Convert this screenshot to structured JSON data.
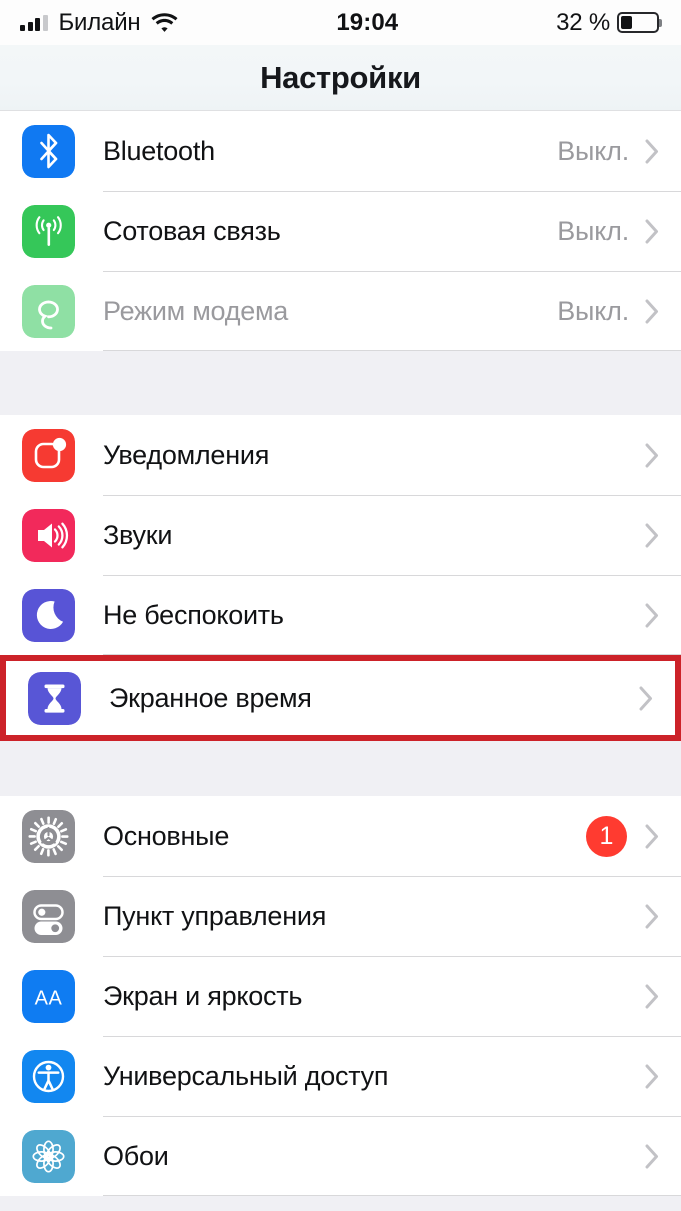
{
  "status_bar": {
    "carrier": "Билайн",
    "signal_bars_total": 4,
    "signal_bars_filled": 3,
    "wifi_icon": "wifi-icon",
    "time": "19:04",
    "battery_percent_label": "32 %",
    "battery_level": 32
  },
  "navbar": {
    "title": "Настройки"
  },
  "groups": [
    {
      "id": "connectivity",
      "rows": [
        {
          "id": "bluetooth",
          "icon": "bluetooth-icon",
          "icon_color": "#1079f2",
          "label": "Bluetooth",
          "value": "Выкл.",
          "disabled": false,
          "chevron": true,
          "badge": null
        },
        {
          "id": "cellular",
          "icon": "cellular-antenna-icon",
          "icon_color": "#35c759",
          "label": "Сотовая связь",
          "value": "Выкл.",
          "disabled": false,
          "chevron": true,
          "badge": null
        },
        {
          "id": "hotspot",
          "icon": "personal-hotspot-icon",
          "icon_color": "#8fe0a4",
          "label": "Режим модема",
          "value": "Выкл.",
          "disabled": true,
          "chevron": true,
          "badge": null
        }
      ]
    },
    {
      "id": "alerts",
      "rows": [
        {
          "id": "notifications",
          "icon": "notifications-icon",
          "icon_color": "#f63a32",
          "label": "Уведомления",
          "value": "",
          "disabled": false,
          "chevron": true,
          "badge": null
        },
        {
          "id": "sounds",
          "icon": "speaker-icon",
          "icon_color": "#f2295b",
          "label": "Звуки",
          "value": "",
          "disabled": false,
          "chevron": true,
          "badge": null
        },
        {
          "id": "do-not-disturb",
          "icon": "moon-icon",
          "icon_color": "#5854d6",
          "label": "Не беспокоить",
          "value": "",
          "disabled": false,
          "chevron": true,
          "badge": null
        }
      ]
    },
    {
      "id": "screen-time",
      "highlighted": true,
      "highlight_color": "#cc2229",
      "rows": [
        {
          "id": "screen-time",
          "icon": "hourglass-icon",
          "icon_color": "#5856d6",
          "label": "Экранное время",
          "value": "",
          "disabled": false,
          "chevron": true,
          "badge": null
        }
      ]
    },
    {
      "id": "system",
      "rows": [
        {
          "id": "general",
          "icon": "gear-icon",
          "icon_color": "#8e8e93",
          "label": "Основные",
          "value": "",
          "disabled": false,
          "chevron": true,
          "badge": "1"
        },
        {
          "id": "control-center",
          "icon": "toggles-icon",
          "icon_color": "#8e8e93",
          "label": "Пункт управления",
          "value": "",
          "disabled": false,
          "chevron": true,
          "badge": null
        },
        {
          "id": "display",
          "icon": "text-size-aa-icon",
          "icon_color": "#0f7cf2",
          "label": "Экран и яркость",
          "value": "",
          "disabled": false,
          "chevron": true,
          "badge": null
        },
        {
          "id": "accessibility",
          "icon": "accessibility-icon",
          "icon_color": "#1287f0",
          "label": "Универсальный доступ",
          "value": "",
          "disabled": false,
          "chevron": true,
          "badge": null
        },
        {
          "id": "wallpaper",
          "icon": "wallpaper-flower-icon",
          "icon_color": "#4fa8d0",
          "label": "Обои",
          "value": "",
          "disabled": false,
          "chevron": true,
          "badge": null
        }
      ]
    }
  ],
  "colors": {
    "badge_red": "#ff3b30",
    "highlight_red": "#cc2229",
    "group_gap": "#f0f0f4",
    "separator": "#d8d8da",
    "secondary_text": "#9a9a9e"
  }
}
